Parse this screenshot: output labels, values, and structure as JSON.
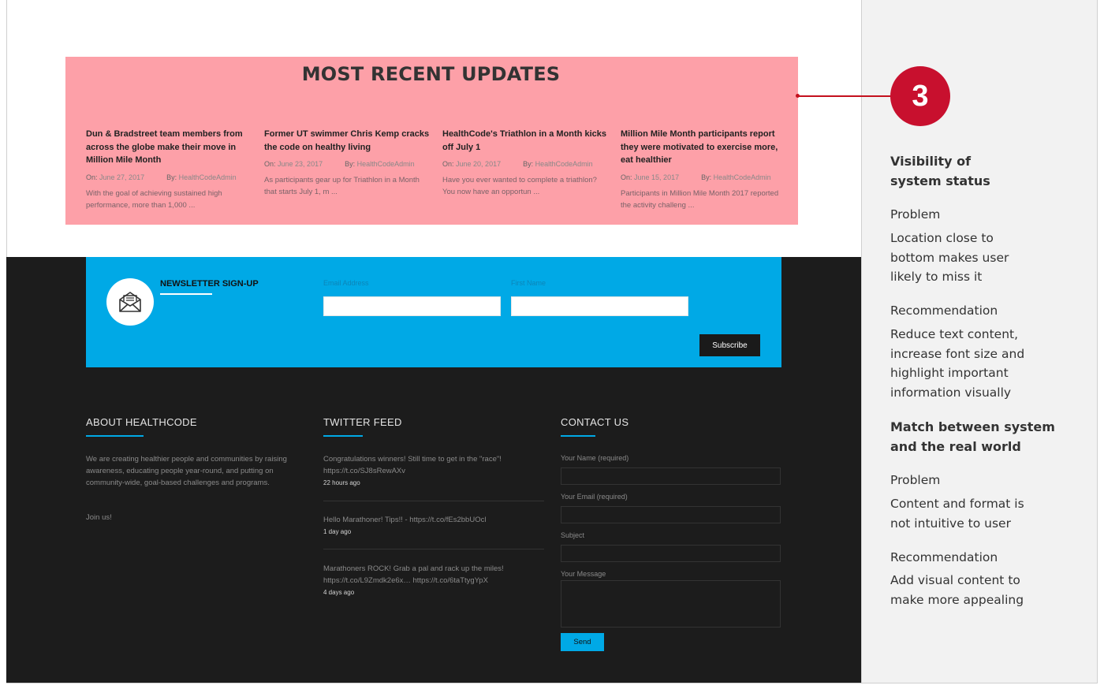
{
  "recent_updates": {
    "title": "MOST RECENT UPDATES",
    "posts": [
      {
        "title": "Dun & Bradstreet team members from across the globe make their move in Million Mile Month",
        "on_label": "On:",
        "date": "June 27, 2017",
        "by_label": "By:",
        "author": "HealthCodeAdmin",
        "excerpt": "With the goal of achieving sustained high performance, more than 1,000 ..."
      },
      {
        "title": "Former UT swimmer Chris Kemp cracks the code on healthy living",
        "on_label": "On:",
        "date": "June 23, 2017",
        "by_label": "By:",
        "author": "HealthCodeAdmin",
        "excerpt": "As participants gear up for Triathlon in a Month that starts July 1, m ..."
      },
      {
        "title": "HealthCode's Triathlon in a Month kicks off July 1",
        "on_label": "On:",
        "date": "June 20, 2017",
        "by_label": "By:",
        "author": "HealthCodeAdmin",
        "excerpt": "Have you ever wanted to complete a triathlon? You now have an opportun ..."
      },
      {
        "title": "Million Mile Month participants report they were motivated to exercise more, eat healthier",
        "on_label": "On:",
        "date": "June 15, 2017",
        "by_label": "By:",
        "author": "HealthCodeAdmin",
        "excerpt": "Participants in Million Mile Month 2017 reported the activity challeng ..."
      }
    ]
  },
  "newsletter": {
    "title": "NEWSLETTER SIGN-UP",
    "email_label": "Email Address",
    "name_label": "First Name",
    "subscribe_label": "Subscribe",
    "icon": "envelope-open-icon"
  },
  "about": {
    "title": "ABOUT HEALTHCODE",
    "text": "We are creating healthier people and communities by raising awareness, educating people year-round, and putting on community-wide, goal-based challenges and programs.",
    "join": "Join us!"
  },
  "twitter": {
    "title": "TWITTER FEED",
    "tweets": [
      {
        "text": "Congratulations winners! Still time to get in the \"race\"! https://t.co/SJ8sRewAXv",
        "ago": "22 hours ago"
      },
      {
        "text": "Hello Marathoner! Tips!! - https://t.co/fEs2bbUOcl",
        "ago": "1 day ago"
      },
      {
        "text": "Marathoners ROCK! Grab a pal and rack up the miles! https://t.co/L9Zmdk2e6x… https://t.co/6taTtygYpX",
        "ago": "4 days ago"
      }
    ]
  },
  "contact": {
    "title": "CONTACT US",
    "name_label": "Your Name (required)",
    "email_label": "Your Email (required)",
    "subject_label": "Subject",
    "message_label": "Your Message",
    "send_label": "Send"
  },
  "annotation": {
    "badge": "3",
    "section1": {
      "heading_line1": "Visibility of",
      "heading_line2": "system status",
      "problem_label": "Problem",
      "problem_lines": [
        "Location close to",
        "bottom makes user",
        "likely to miss it"
      ],
      "recommendation_label": "Recommendation",
      "recommendation_lines": [
        "Reduce text content,",
        "increase font size and",
        "highlight important",
        "information visually"
      ]
    },
    "section2": {
      "heading_line1": "Match between system",
      "heading_line2": "and the real world",
      "problem_label": "Problem",
      "problem_lines": [
        "Content and format is",
        "not intuitive to user"
      ],
      "recommendation_label": "Recommendation",
      "recommendation_lines": [
        "Add visual content to",
        "make more appealing"
      ]
    }
  },
  "colors": {
    "highlight": "#fda0a8",
    "accent_blue": "#00a9e6",
    "footer_bg": "#1c1c1c",
    "badge_red": "#c8102e"
  }
}
